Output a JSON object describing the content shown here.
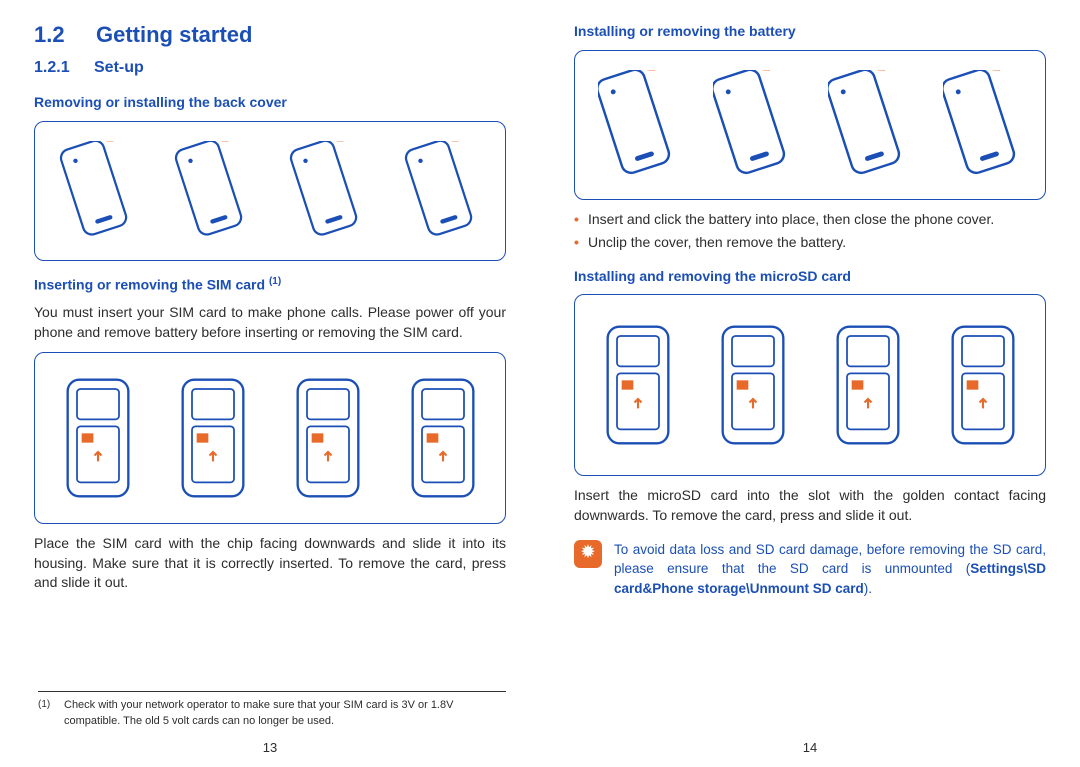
{
  "left": {
    "page_no": "13",
    "h1_num": "1.2",
    "h1_title": "Getting started",
    "h2_num": "1.2.1",
    "h2_title": "Set-up",
    "topic_cover": "Removing or installing the back cover",
    "topic_sim": "Inserting or removing the SIM card",
    "sim_fn_mark": "(1)",
    "sim_intro": "You must insert your SIM card to make phone calls. Please power off your phone and remove battery before inserting or removing the SIM card.",
    "sim_after": "Place the SIM card with the chip facing downwards and slide it into its housing. Make sure that it is correctly inserted. To remove the card, press and slide it out.",
    "footnote_mark": "(1)",
    "footnote_text": "Check with your network operator to make sure that your SIM card is 3V or 1.8V compatible. The old 5 volt cards can no longer be used."
  },
  "right": {
    "page_no": "14",
    "topic_batt": "Installing or removing the battery",
    "batt_b1": "Insert and click the battery into place, then close the phone cover.",
    "batt_b2": "Unclip the cover, then remove the battery.",
    "topic_sd": "Installing and removing the microSD card",
    "sd_after": "Insert the microSD card into the slot with the golden contact facing downwards. To remove the card, press and slide it out.",
    "tip_text_1": "To avoid data loss and SD card damage, before removing the SD card, please ensure that the SD card is unmounted (",
    "tip_bold": "Settings\\SD card&Phone storage\\Unmount SD card",
    "tip_text_2": ")."
  },
  "icons": {
    "tip_glyph": "✹"
  }
}
